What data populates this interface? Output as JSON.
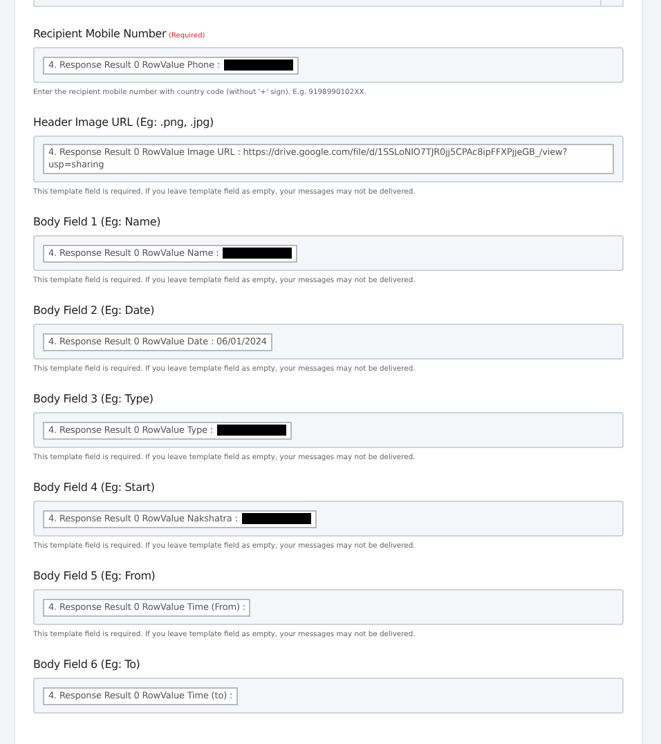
{
  "fields": [
    {
      "label": "Recipient Mobile Number",
      "required_mark": "(Required)",
      "token": "4. Response Result 0 RowValue Phone :",
      "redacted": true,
      "hint": "Enter the recipient mobile number with country code (without '+' sign). E.g. 9198990102XX."
    },
    {
      "label": "Header Image URL (Eg: .png, .jpg)",
      "token": "4. Response Result 0 RowValue Image URL : https://drive.google.com/file/d/1SSLoNIO7TJR0jj5CPAc8ipFFXPjjeGB_/view?usp=sharing",
      "redacted": false,
      "hint": "This template field is required. If you leave template field as empty, your messages may not be delivered."
    },
    {
      "label": "Body Field 1 (Eg: Name)",
      "token": "4. Response Result 0 RowValue Name :",
      "redacted": true,
      "hint": "This template field is required. If you leave template field as empty, your messages may not be delivered."
    },
    {
      "label": "Body Field 2 (Eg: Date)",
      "token": "4. Response Result 0 RowValue Date : 06/01/2024",
      "redacted": false,
      "hint": "This template field is required. If you leave template field as empty, your messages may not be delivered."
    },
    {
      "label": "Body Field 3 (Eg: Type)",
      "token": "4. Response Result 0 RowValue Type :",
      "redacted": true,
      "hint": "This template field is required. If you leave template field as empty, your messages may not be delivered."
    },
    {
      "label": "Body Field 4 (Eg: Start)",
      "token": "4. Response Result 0 RowValue Nakshatra :",
      "redacted": true,
      "hint": "This template field is required. If you leave template field as empty, your messages may not be delivered."
    },
    {
      "label": "Body Field 5 (Eg: From)",
      "token": "4. Response Result 0 RowValue Time (From) :",
      "redacted": false,
      "hint": "This template field is required. If you leave template field as empty, your messages may not be delivered."
    },
    {
      "label": "Body Field 6 (Eg: To)",
      "token": "4. Response Result 0 RowValue Time (to) :",
      "redacted": false
    }
  ]
}
